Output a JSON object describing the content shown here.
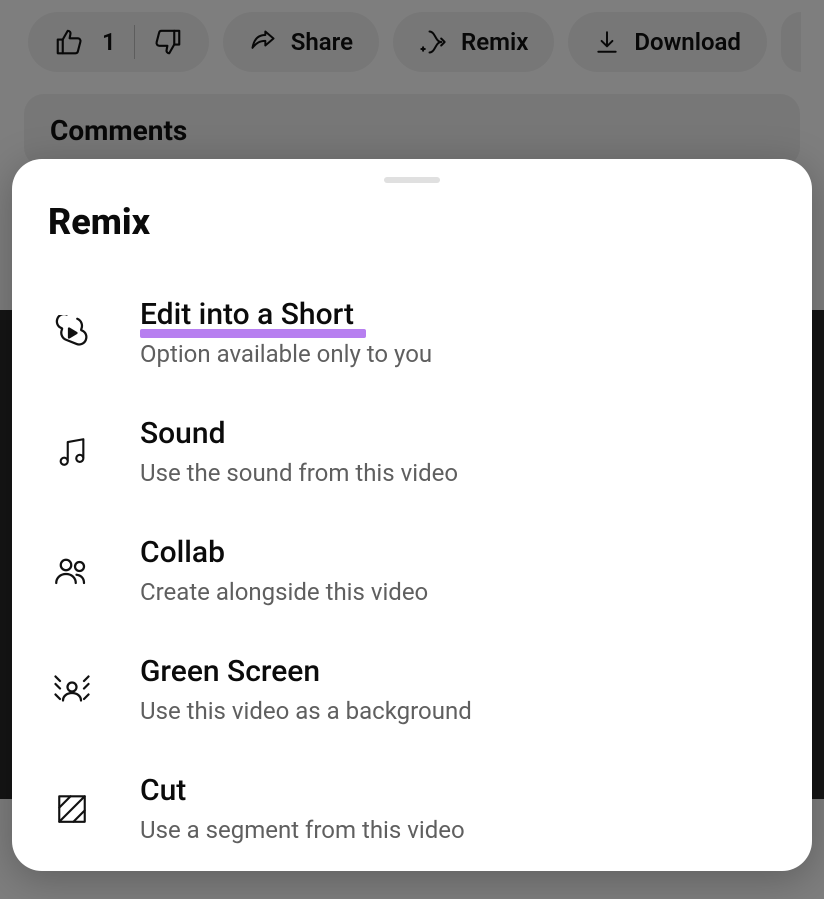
{
  "actions": {
    "like_count": "1",
    "share_label": "Share",
    "remix_label": "Remix",
    "download_label": "Download"
  },
  "comments_label": "Comments",
  "sheet": {
    "title": "Remix",
    "items": [
      {
        "title": "Edit into a Short",
        "subtitle": "Option available only to you",
        "highlight": true,
        "icon": "shorts-icon"
      },
      {
        "title": "Sound",
        "subtitle": "Use the sound from this video",
        "highlight": false,
        "icon": "music-icon"
      },
      {
        "title": "Collab",
        "subtitle": "Create alongside this video",
        "highlight": false,
        "icon": "people-icon"
      },
      {
        "title": "Green Screen",
        "subtitle": "Use this video as a background",
        "highlight": false,
        "icon": "greenscreen-icon"
      },
      {
        "title": "Cut",
        "subtitle": "Use a segment from this video",
        "highlight": false,
        "icon": "cut-icon"
      }
    ]
  }
}
